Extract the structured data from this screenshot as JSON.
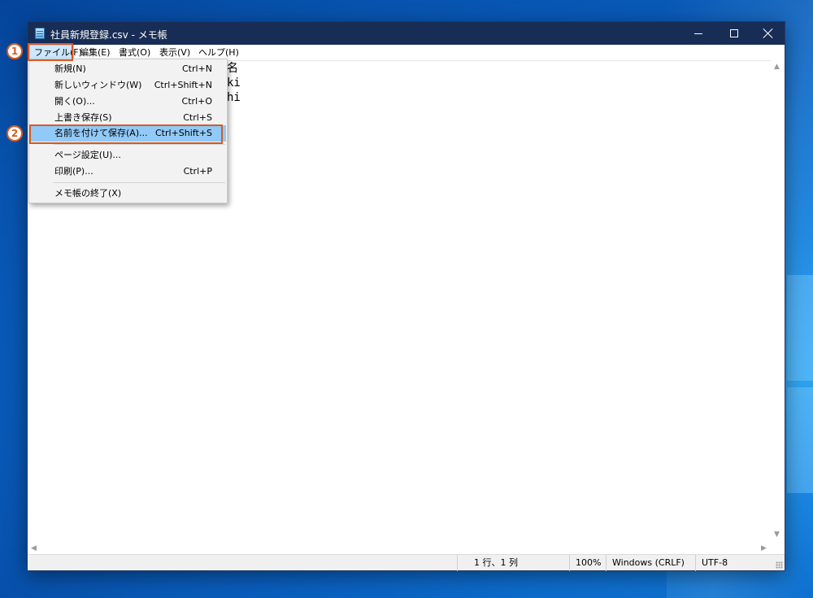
{
  "window": {
    "title": "社員新規登録.csv - メモ帳"
  },
  "menubar": {
    "file": "ファイル(F)",
    "edit": "編集(E)",
    "format": "書式(O)",
    "view": "表示(V)",
    "help": "ヘルプ(H)"
  },
  "editor": {
    "lines": [
      "名",
      "ki",
      "hi"
    ]
  },
  "file_menu": {
    "items": [
      {
        "label": "新規(N)",
        "accel": "Ctrl+N"
      },
      {
        "label": "新しいウィンドウ(W)",
        "accel": "Ctrl+Shift+N"
      },
      {
        "label": "開く(O)...",
        "accel": "Ctrl+O"
      },
      {
        "label": "上書き保存(S)",
        "accel": "Ctrl+S"
      },
      {
        "label": "名前を付けて保存(A)...",
        "accel": "Ctrl+Shift+S",
        "highlighted": true
      },
      {
        "label": "ページ設定(U)...",
        "accel": ""
      },
      {
        "label": "印刷(P)...",
        "accel": "Ctrl+P"
      },
      {
        "label": "メモ帳の終了(X)",
        "accel": ""
      }
    ]
  },
  "statusbar": {
    "position": "1 行、1 列",
    "zoom": "100%",
    "line_ending": "Windows (CRLF)",
    "encoding": "UTF-8"
  },
  "annotations": {
    "step1": "1",
    "step2": "2",
    "color": "#d65a22"
  },
  "colors": {
    "titlebar": "#182d56",
    "menu_highlight": "#91c9f7",
    "desktop": "#0a6fcf"
  }
}
